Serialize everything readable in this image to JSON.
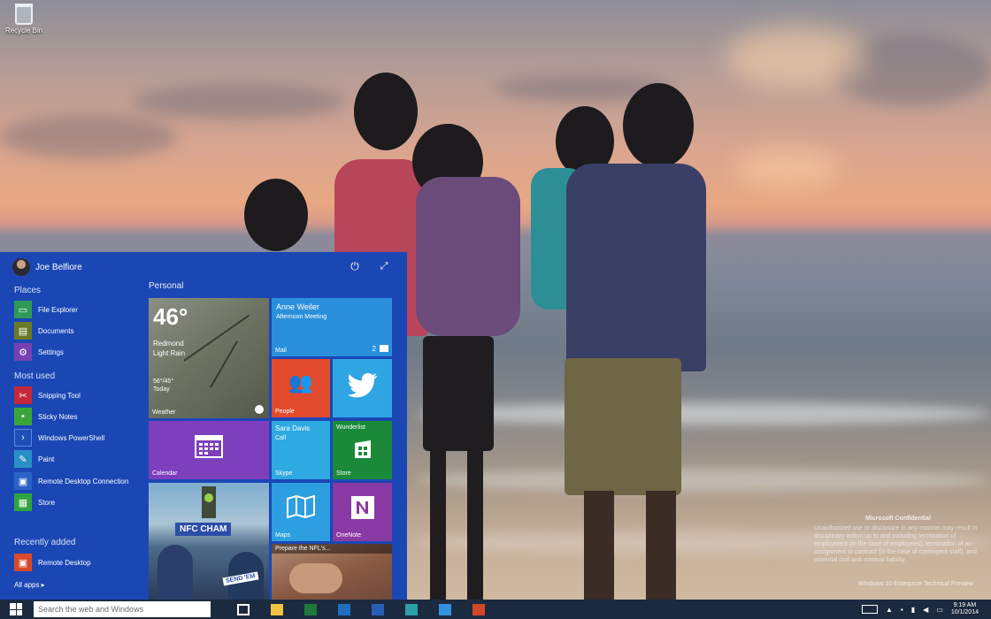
{
  "desktop": {
    "recycle_bin_label": "Recycle Bin",
    "watermark": {
      "title": "Microsoft Confidential",
      "body": "Unauthorized use or disclosure in any manner may result in disciplinary action up to and including termination of employment (in the case of employees), termination of an assignment or contract (in the case of contingent staff), and potential civil and criminal liability.",
      "build": "Windows 10 Enterprise Technical Preview"
    }
  },
  "start_menu": {
    "user_name": "Joe Belfiore",
    "places_heading": "Places",
    "places": [
      {
        "label": "File Explorer",
        "icon": "folder-icon",
        "color": "#2e9b57"
      },
      {
        "label": "Documents",
        "icon": "documents-icon",
        "color": "#6b7a2a"
      },
      {
        "label": "Settings",
        "icon": "gear-icon",
        "color": "#7542b3"
      }
    ],
    "most_used_heading": "Most used",
    "most_used": [
      {
        "label": "Snipping Tool",
        "icon": "scissors-icon",
        "color": "#c4283a"
      },
      {
        "label": "Sticky Notes",
        "icon": "sticky-note-icon",
        "color": "#3aa63a"
      },
      {
        "label": "Windows PowerShell",
        "icon": "powershell-icon",
        "color": "#1f4fb5"
      },
      {
        "label": "Paint",
        "icon": "paint-icon",
        "color": "#2b8fc6"
      },
      {
        "label": "Remote Desktop Connection",
        "icon": "remote-desktop-icon",
        "color": "#2a63c7"
      },
      {
        "label": "Store",
        "icon": "store-icon",
        "color": "#2fa53f"
      }
    ],
    "recently_added_heading": "Recently added",
    "recently_added": [
      {
        "label": "Remote Desktop",
        "icon": "remote-desktop-icon",
        "color": "#d84a2a"
      }
    ],
    "all_apps_label": "All apps ▸",
    "personal_label": "Personal",
    "tiles": {
      "weather": {
        "temp": "46°",
        "city": "Redmond",
        "condition": "Light Rain",
        "hilo_1": "56°/45°",
        "hilo_2": "Today",
        "name": "Weather"
      },
      "mail": {
        "sender": "Anne Weiler",
        "subject": "Afternoon Meeting",
        "name": "Mail",
        "count": "2"
      },
      "people": {
        "name": "People"
      },
      "twitter": {
        "name": ""
      },
      "calendar": {
        "name": "Calendar"
      },
      "skype": {
        "sender": "Sara Davis",
        "status": "Call",
        "name": "Skype"
      },
      "store": {
        "app": "Wunderlist",
        "name": "Store"
      },
      "photo": {
        "banner": "NFC CHAM",
        "sign": "SEND 'EM"
      },
      "maps": {
        "name": "Maps"
      },
      "onenote": {
        "name": "OneNote"
      },
      "news": {
        "headline": "Prepare the NFL's..."
      }
    }
  },
  "taskbar": {
    "search_placeholder": "Search the web and Windows",
    "time": "9:19 AM",
    "date": "10/1/2014",
    "tray_label": "▲"
  }
}
